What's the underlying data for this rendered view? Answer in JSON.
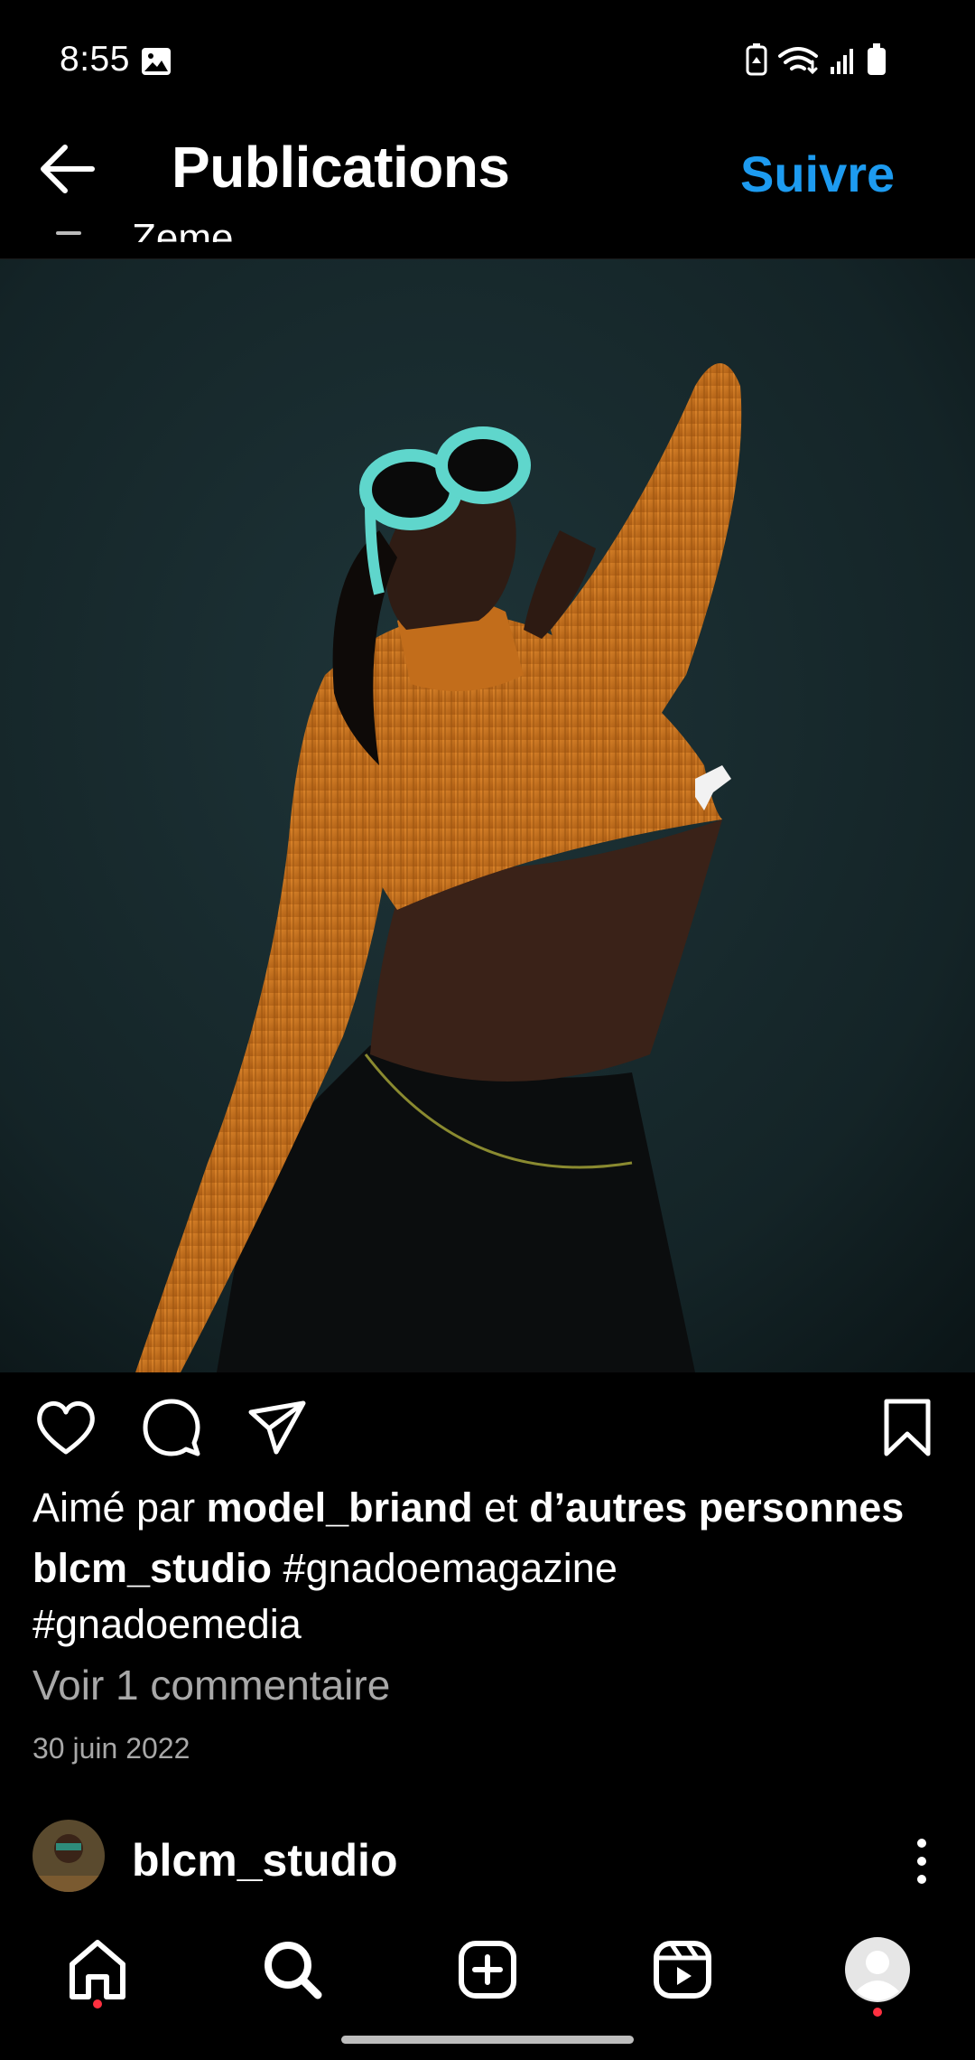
{
  "status_bar": {
    "time": "8:55",
    "icons": [
      "gallery-icon",
      "battery-saver-icon",
      "wifi-icon",
      "signal-icon",
      "battery-icon"
    ]
  },
  "header": {
    "title": "Publications",
    "follow_label": "Suivre",
    "prev_post_username_fragment": "Zeme"
  },
  "post": {
    "image_description_icon": "photo",
    "likes": {
      "prefix": "Aimé par ",
      "user": "model_briand",
      "middle": " et ",
      "others": "d’autres personnes"
    },
    "caption": {
      "username": "blcm_studio",
      "hashtags": [
        " #gnadoemagazine",
        "#gnadoemedia"
      ]
    },
    "comments_link": "Voir 1 commentaire",
    "date": "30 juin 2022"
  },
  "next_post": {
    "username": "blcm_studio"
  },
  "colors": {
    "accent": "#1d9bf0",
    "muted_text": "#a8a8a8",
    "notification_dot": "#ff3040",
    "sweater": "#c8741c",
    "background": "#000000"
  },
  "bottom_nav": {
    "items": [
      "home-icon",
      "search-icon",
      "create-icon",
      "reels-icon",
      "profile-icon"
    ]
  }
}
